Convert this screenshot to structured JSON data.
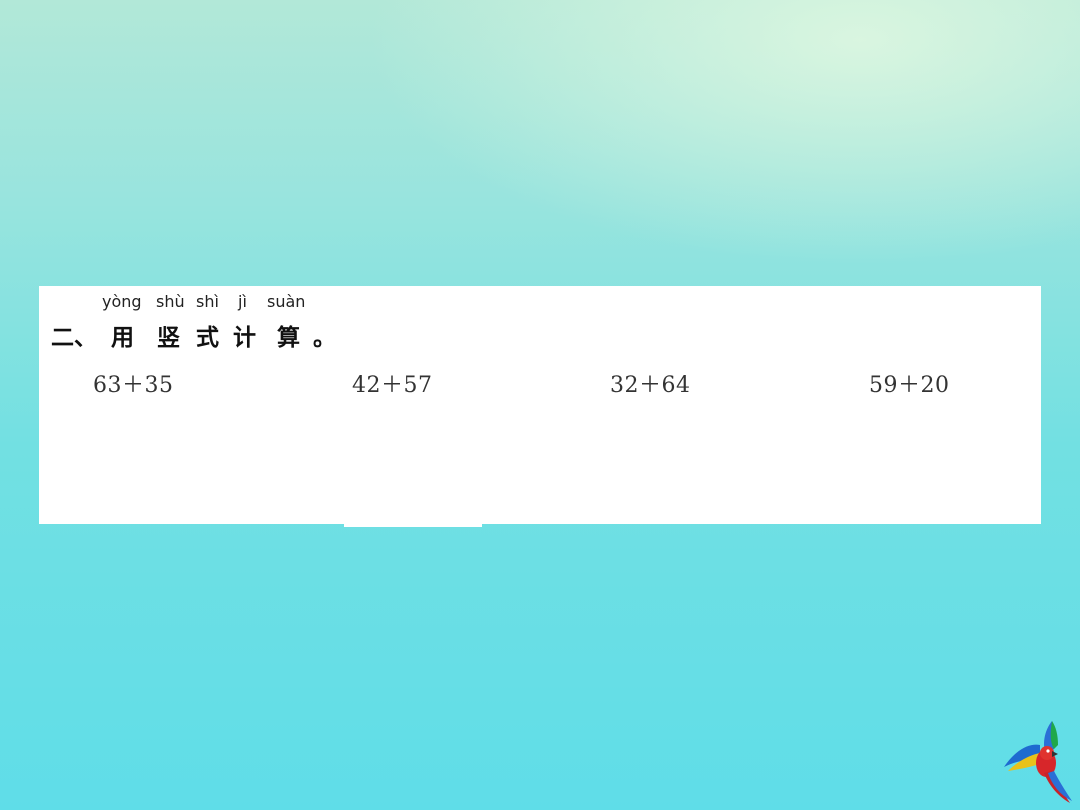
{
  "exercise": {
    "number": "二、",
    "pinyin": [
      "yòng",
      "shù",
      "shì",
      "jì",
      "suàn"
    ],
    "chars": [
      "用",
      "竖",
      "式",
      "计",
      "算"
    ],
    "period": "。",
    "problems": [
      "63＋35",
      "42＋57",
      "32＋64",
      "59＋20"
    ]
  },
  "colors": {
    "background_top": "#b2e8d8",
    "background_bottom": "#5fdde8",
    "card": "#ffffff"
  },
  "decoration": {
    "icon": "parrot-icon"
  }
}
